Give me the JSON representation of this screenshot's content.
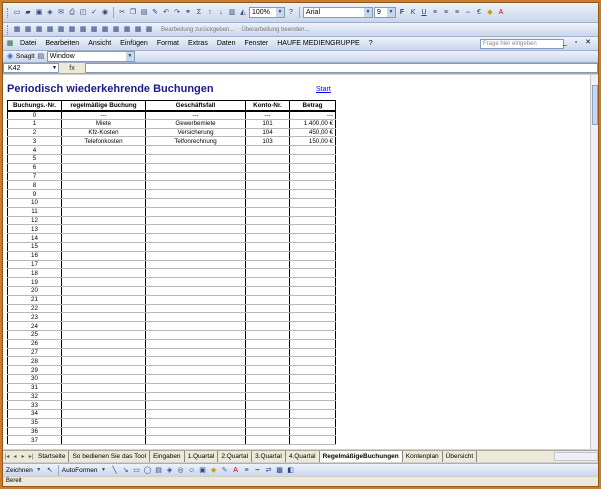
{
  "toolbar": {
    "zoom": "100%",
    "font_name": "Arial",
    "font_size": "9",
    "help_placeholder": "Frage hier eingeben",
    "review_reply": "Bearbeitung zurückgeben...",
    "review_end": "Überarbeitung beenden..."
  },
  "menu": [
    "Datei",
    "Bearbeiten",
    "Ansicht",
    "Einfügen",
    "Format",
    "Extras",
    "Daten",
    "Fenster",
    "HAUFE MEDIENGRUPPE",
    "?"
  ],
  "snagit": {
    "label": "SnagIt",
    "target": "Window"
  },
  "formula": {
    "namebox": "K42",
    "fx": "fx"
  },
  "sheet": {
    "title": "Periodisch wiederkehrende Buchungen",
    "start_link": "Start",
    "columns": [
      "Buchungs.-Nr.",
      "regelmäßige Buchung",
      "Geschäftsfall",
      "Konto-Nr.",
      "Betrag"
    ],
    "rows": [
      [
        "0",
        "---",
        "---",
        "---",
        "---"
      ],
      [
        "1",
        "Miete",
        "Gewerbemiete",
        "101",
        "1.400,00 €"
      ],
      [
        "2",
        "Kfz-Kosten",
        "Versicherung",
        "104",
        "450,00 €"
      ],
      [
        "3",
        "Telefonkosten",
        "Telfonrechnung",
        "103",
        "150,00 €"
      ],
      [
        "4",
        "",
        "",
        "",
        ""
      ],
      [
        "5",
        "",
        "",
        "",
        ""
      ],
      [
        "6",
        "",
        "",
        "",
        ""
      ],
      [
        "7",
        "",
        "",
        "",
        ""
      ],
      [
        "8",
        "",
        "",
        "",
        ""
      ],
      [
        "9",
        "",
        "",
        "",
        ""
      ],
      [
        "10",
        "",
        "",
        "",
        ""
      ],
      [
        "11",
        "",
        "",
        "",
        ""
      ],
      [
        "12",
        "",
        "",
        "",
        ""
      ],
      [
        "13",
        "",
        "",
        "",
        ""
      ],
      [
        "14",
        "",
        "",
        "",
        ""
      ],
      [
        "15",
        "",
        "",
        "",
        ""
      ],
      [
        "16",
        "",
        "",
        "",
        ""
      ],
      [
        "17",
        "",
        "",
        "",
        ""
      ],
      [
        "18",
        "",
        "",
        "",
        ""
      ],
      [
        "19",
        "",
        "",
        "",
        ""
      ],
      [
        "20",
        "",
        "",
        "",
        ""
      ],
      [
        "21",
        "",
        "",
        "",
        ""
      ],
      [
        "22",
        "",
        "",
        "",
        ""
      ],
      [
        "23",
        "",
        "",
        "",
        ""
      ],
      [
        "24",
        "",
        "",
        "",
        ""
      ],
      [
        "25",
        "",
        "",
        "",
        ""
      ],
      [
        "26",
        "",
        "",
        "",
        ""
      ],
      [
        "27",
        "",
        "",
        "",
        ""
      ],
      [
        "28",
        "",
        "",
        "",
        ""
      ],
      [
        "29",
        "",
        "",
        "",
        ""
      ],
      [
        "30",
        "",
        "",
        "",
        ""
      ],
      [
        "31",
        "",
        "",
        "",
        ""
      ],
      [
        "32",
        "",
        "",
        "",
        ""
      ],
      [
        "33",
        "",
        "",
        "",
        ""
      ],
      [
        "34",
        "",
        "",
        "",
        ""
      ],
      [
        "35",
        "",
        "",
        "",
        ""
      ],
      [
        "36",
        "",
        "",
        "",
        ""
      ],
      [
        "37",
        "",
        "",
        "",
        ""
      ]
    ]
  },
  "tabs": {
    "items": [
      "Startseite",
      "So bedienen Sie das Tool",
      "Eingaben",
      "1.Quartal",
      "2.Quartal",
      "3.Quartal",
      "4.Quartal",
      "RegelmäßigeBuchungen",
      "Kontenplan",
      "Übersicht"
    ],
    "active_index": 7
  },
  "drawbar": {
    "zeichnen": "Zeichnen",
    "autoformen": "AutoFormen"
  },
  "statusbar": {
    "text": "Bereit"
  },
  "colors": {
    "title": "#1a1a8a",
    "window_border": "#d07a2c",
    "toolbar": "#c9d6ec"
  }
}
